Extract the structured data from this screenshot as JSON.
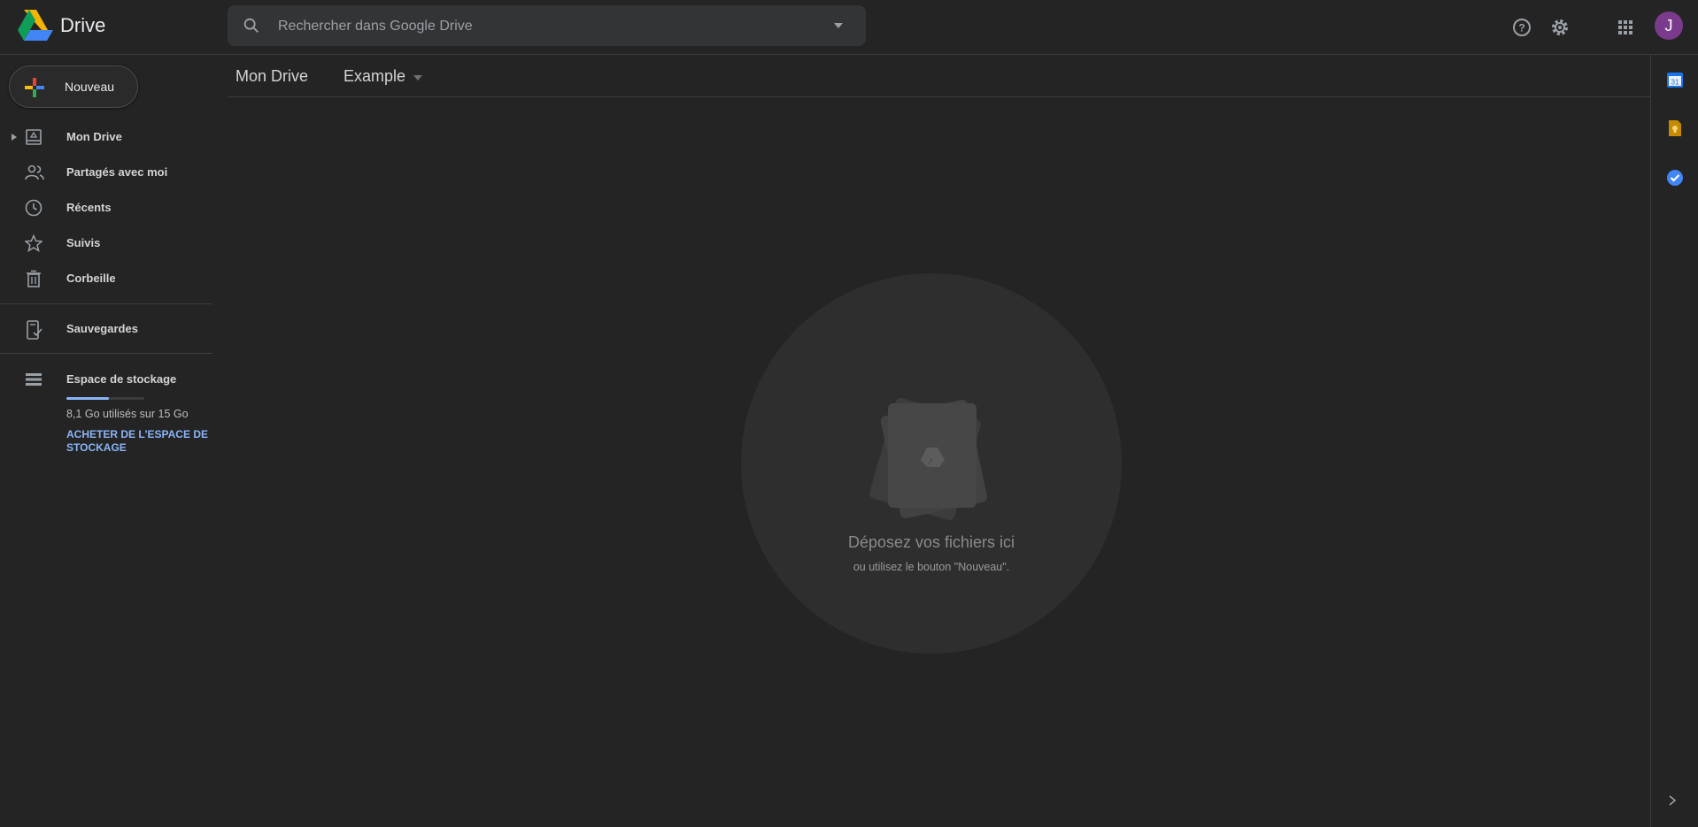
{
  "app": {
    "title": "Drive",
    "logo_icon": "google-drive-logo"
  },
  "search": {
    "placeholder": "Rechercher dans Google Drive",
    "icon": "search-icon",
    "options_icon": "caret-down-icon"
  },
  "header_actions": {
    "help_icon": "help-icon",
    "settings_icon": "gear-icon",
    "apps_icon": "apps-grid-icon",
    "avatar_initial": "J",
    "avatar_color": "#7b3b8c"
  },
  "new_button": {
    "label": "Nouveau"
  },
  "sidebar": {
    "items": [
      {
        "label": "Mon Drive",
        "icon": "my-drive-icon"
      },
      {
        "label": "Partagés avec moi",
        "icon": "shared-people-icon"
      },
      {
        "label": "Récents",
        "icon": "clock-icon"
      },
      {
        "label": "Suivis",
        "icon": "star-icon"
      },
      {
        "label": "Corbeille",
        "icon": "trash-icon"
      }
    ],
    "backups": {
      "label": "Sauvegardes",
      "icon": "backup-device-icon"
    },
    "storage": {
      "label": "Espace de stockage",
      "icon": "storage-icon",
      "used_text": "8,1 Go utilisés sur 15 Go",
      "used_fraction": 0.54,
      "buy_link": "ACHETER DE L'ESPACE DE STOCKAGE"
    }
  },
  "breadcrumb": {
    "root": "Mon Drive",
    "current": "Example"
  },
  "empty_state": {
    "title": "Déposez vos fichiers ici",
    "subtitle": "ou utilisez le bouton \"Nouveau\"."
  },
  "side_apps": [
    {
      "name": "calendar",
      "icon": "calendar-icon",
      "text": "31",
      "color": "#4285f4"
    },
    {
      "name": "keep",
      "icon": "keep-icon",
      "color": "#c58a00"
    },
    {
      "name": "tasks",
      "icon": "tasks-icon",
      "color": "#4285f4"
    }
  ],
  "colors": {
    "accent": "#8ab4f8",
    "background": "#242424"
  }
}
